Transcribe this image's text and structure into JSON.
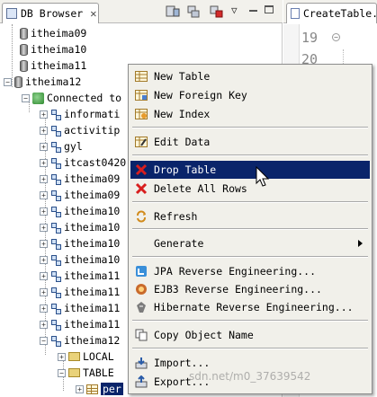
{
  "view": {
    "tab_title": "DB Browser",
    "tab_close": "✕",
    "menu_glyph": "▽"
  },
  "tree": {
    "items": [
      {
        "label": "itheima09",
        "icon": "database-icon"
      },
      {
        "label": "itheima10",
        "icon": "database-icon"
      },
      {
        "label": "itheima11",
        "icon": "database-icon"
      },
      {
        "label": "itheima12",
        "icon": "database-icon",
        "expander": "−"
      },
      {
        "label": "Connected to",
        "icon": "connection-icon",
        "expander": "−"
      },
      {
        "label": "informati",
        "icon": "schema-icon",
        "expander": "+"
      },
      {
        "label": "activitip",
        "icon": "schema-icon",
        "expander": "+"
      },
      {
        "label": "gyl",
        "icon": "schema-icon",
        "expander": "+"
      },
      {
        "label": "itcast0420",
        "icon": "schema-icon",
        "expander": "+"
      },
      {
        "label": "itheima09",
        "icon": "schema-icon",
        "expander": "+"
      },
      {
        "label": "itheima09",
        "icon": "schema-icon",
        "expander": "+"
      },
      {
        "label": "itheima10",
        "icon": "schema-icon",
        "expander": "+"
      },
      {
        "label": "itheima10",
        "icon": "schema-icon",
        "expander": "+"
      },
      {
        "label": "itheima10",
        "icon": "schema-icon",
        "expander": "+"
      },
      {
        "label": "itheima10",
        "icon": "schema-icon",
        "expander": "+"
      },
      {
        "label": "itheima11",
        "icon": "schema-icon",
        "expander": "+"
      },
      {
        "label": "itheima11",
        "icon": "schema-icon",
        "expander": "+"
      },
      {
        "label": "itheima11",
        "icon": "schema-icon",
        "expander": "+"
      },
      {
        "label": "itheima11",
        "icon": "schema-icon",
        "expander": "+"
      },
      {
        "label": "itheima12",
        "icon": "schema-icon",
        "expander": "−"
      },
      {
        "label": "LOCAL",
        "icon": "folder-icon",
        "expander": "+"
      },
      {
        "label": "TABLE",
        "icon": "folder-icon",
        "expander": "−"
      },
      {
        "label": "per",
        "icon": "table-icon",
        "expander": "+",
        "selected": true
      }
    ]
  },
  "editor": {
    "tab_title": "CreateTable.",
    "line_numbers": [
      "19",
      "20"
    ],
    "fold_glyph": "−"
  },
  "context_menu": {
    "items": [
      {
        "label": "New Table",
        "icon": "table-icon"
      },
      {
        "label": "New Foreign Key",
        "icon": "foreign-key-icon"
      },
      {
        "label": "New Index",
        "icon": "index-icon"
      },
      {
        "label": "Edit Data",
        "icon": "edit-data-icon"
      },
      {
        "label": "Drop Table",
        "icon": "delete-icon",
        "highlighted": true
      },
      {
        "label": "Delete All Rows",
        "icon": "delete-icon"
      },
      {
        "label": "Refresh",
        "icon": "refresh-icon"
      },
      {
        "label": "Generate",
        "icon": "",
        "submenu": true
      },
      {
        "label": "JPA Reverse Engineering...",
        "icon": "jpa-icon"
      },
      {
        "label": "EJB3 Reverse Engineering...",
        "icon": "ejb3-icon"
      },
      {
        "label": "Hibernate Reverse Engineering...",
        "icon": "hibernate-icon"
      },
      {
        "label": "Copy Object Name",
        "icon": "copy-icon"
      },
      {
        "label": "Import...",
        "icon": "import-icon"
      },
      {
        "label": "Export...",
        "icon": "export-icon"
      }
    ]
  },
  "watermark": "sdn.net/m0_37639542",
  "colors": {
    "selection": "#0a246a",
    "menu_bg": "#f1f0ea",
    "delete_red": "#d81e1e"
  }
}
